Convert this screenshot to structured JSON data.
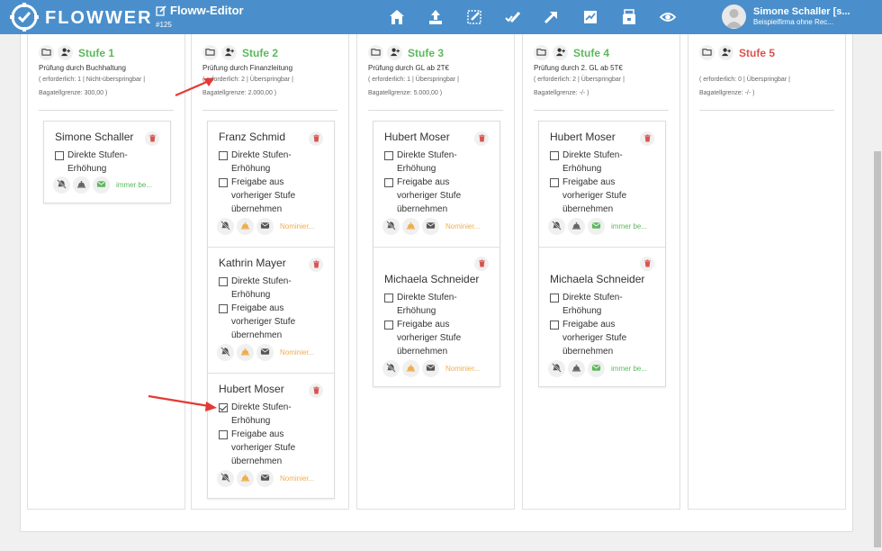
{
  "header": {
    "brand": "FLOWWER",
    "editor_title": "Floww-Editor",
    "editor_id": "#125",
    "user_name": "Simone Schaller [s...",
    "user_firm": "Beispielfirma ohne Rec..."
  },
  "columns": [
    {
      "title": "Stufe 1",
      "title_color": "green",
      "desc": "Prüfung durch Buchhaltung",
      "meta1": "( erforderlich: 1 | Nicht-überspringbar |",
      "meta2": "Bagatellgrenze: 300,00 )",
      "persons": [
        {
          "name": "Simone Schaller",
          "opt1": "Direkte Stufen-Erhöhung",
          "opt1_checked": false,
          "opt2": null,
          "status": "immer be...",
          "status_color": "green"
        }
      ]
    },
    {
      "title": "Stufe 2",
      "title_color": "green",
      "desc": "Prüfung durch Finanzleitung",
      "meta1": "( erforderlich: 2 | Überspringbar |",
      "meta2": "Bagatellgrenze: 2.000,00 )",
      "persons": [
        {
          "name": "Franz Schmid",
          "opt1": "Direkte Stufen-Erhöhung",
          "opt1_checked": false,
          "opt2": "Freigabe aus vorheriger Stufe übernehmen",
          "status": "Nominier...",
          "status_color": "orange"
        },
        {
          "name": "Kathrin Mayer",
          "opt1": "Direkte Stufen-Erhöhung",
          "opt1_checked": false,
          "opt2": "Freigabe aus vorheriger Stufe übernehmen",
          "status": "Nominier...",
          "status_color": "orange"
        },
        {
          "name": "Hubert Moser",
          "opt1": "Direkte Stufen-Erhöhung",
          "opt1_checked": true,
          "opt2": "Freigabe aus vorheriger Stufe übernehmen",
          "status": "Nominier...",
          "status_color": "orange"
        }
      ]
    },
    {
      "title": "Stufe 3",
      "title_color": "green",
      "desc": "Prüfung durch GL ab 2T€",
      "meta1": "( erforderlich: 1 | Überspringbar |",
      "meta2": "Bagatellgrenze: 5.000,00 )",
      "persons": [
        {
          "name": "Hubert Moser",
          "opt1": "Direkte Stufen-Erhöhung",
          "opt1_checked": false,
          "opt2": "Freigabe aus vorheriger Stufe übernehmen",
          "status": "Nominier...",
          "status_color": "orange"
        },
        {
          "name": "Michaela Schneider",
          "opt1": "Direkte Stufen-Erhöhung",
          "opt1_checked": false,
          "opt2": "Freigabe aus vorheriger Stufe übernehmen",
          "status": "Nominier...",
          "status_color": "orange"
        }
      ]
    },
    {
      "title": "Stufe 4",
      "title_color": "green",
      "desc": "Prüfung durch 2. GL ab 5T€",
      "meta1": "( erforderlich: 2 | Überspringbar |",
      "meta2": "Bagatellgrenze: -/- )",
      "persons": [
        {
          "name": "Hubert Moser",
          "opt1": "Direkte Stufen-Erhöhung",
          "opt1_checked": false,
          "opt2": "Freigabe aus vorheriger Stufe übernehmen",
          "status": "immer be...",
          "status_color": "green"
        },
        {
          "name": "Michaela Schneider",
          "opt1": "Direkte Stufen-Erhöhung",
          "opt1_checked": false,
          "opt2": "Freigabe aus vorheriger Stufe übernehmen",
          "status": "immer be...",
          "status_color": "green"
        }
      ]
    },
    {
      "title": "Stufe 5",
      "title_color": "red",
      "desc": "",
      "meta1": "( erforderlich: 0 | Überspringbar |",
      "meta2": "Bagatellgrenze: -/- )",
      "persons": []
    }
  ],
  "colors": {
    "header_bg": "#4a8fcb",
    "stage_green": "#5cb85c",
    "stage_red": "#d9534f",
    "status_orange": "#f0ad4e",
    "arrow_red": "#e53935"
  }
}
